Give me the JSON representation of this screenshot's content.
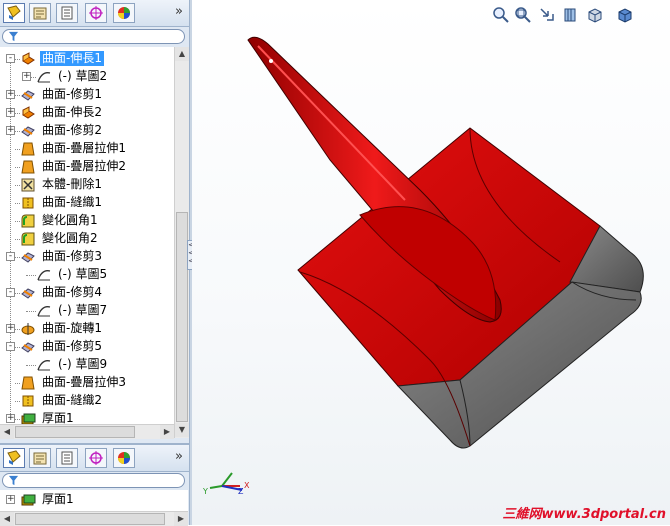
{
  "panel_top": {
    "tabs": [
      "feature-manager-icon",
      "property-manager-icon",
      "configuration-manager-icon",
      "dimxpert-icon",
      "display-manager-icon"
    ],
    "more_label": "»"
  },
  "tree": [
    {
      "label": "曲面-伸長1",
      "icon": "extrude-surface-icon",
      "expand": "-",
      "level": 0,
      "selected": true
    },
    {
      "label": "(-) 草圖2",
      "icon": "sketch-icon",
      "expand": "+",
      "level": 1
    },
    {
      "label": "曲面-修剪1",
      "icon": "trim-surface-icon",
      "expand": "+",
      "level": 0
    },
    {
      "label": "曲面-伸長2",
      "icon": "extrude-surface-icon",
      "expand": "+",
      "level": 0
    },
    {
      "label": "曲面-修剪2",
      "icon": "trim-surface-icon",
      "expand": "+",
      "level": 0
    },
    {
      "label": "曲面-疊層拉伸1",
      "icon": "loft-surface-icon",
      "expand": "",
      "level": 0
    },
    {
      "label": "曲面-疊層拉伸2",
      "icon": "loft-surface-icon",
      "expand": "",
      "level": 0
    },
    {
      "label": "本體-刪除1",
      "icon": "delete-body-icon",
      "expand": "",
      "level": 0
    },
    {
      "label": "曲面-縫織1",
      "icon": "knit-surface-icon",
      "expand": "",
      "level": 0
    },
    {
      "label": "變化圓角1",
      "icon": "fillet-icon",
      "expand": "",
      "level": 0
    },
    {
      "label": "變化圓角2",
      "icon": "fillet-icon",
      "expand": "",
      "level": 0
    },
    {
      "label": "曲面-修剪3",
      "icon": "trim-surface-icon",
      "expand": "-",
      "level": 0
    },
    {
      "label": "(-) 草圖5",
      "icon": "sketch-icon",
      "expand": "",
      "level": 1
    },
    {
      "label": "曲面-修剪4",
      "icon": "trim-surface-icon",
      "expand": "-",
      "level": 0
    },
    {
      "label": "(-) 草圖7",
      "icon": "sketch-icon",
      "expand": "",
      "level": 1
    },
    {
      "label": "曲面-旋轉1",
      "icon": "revolve-surface-icon",
      "expand": "+",
      "level": 0
    },
    {
      "label": "曲面-修剪5",
      "icon": "trim-surface-icon",
      "expand": "-",
      "level": 0
    },
    {
      "label": "(-) 草圖9",
      "icon": "sketch-icon",
      "expand": "",
      "level": 1
    },
    {
      "label": "曲面-疊層拉伸3",
      "icon": "loft-surface-icon",
      "expand": "",
      "level": 0
    },
    {
      "label": "曲面-縫織2",
      "icon": "knit-surface-icon",
      "expand": "",
      "level": 0
    },
    {
      "label": "厚面1",
      "icon": "thicken-icon",
      "expand": "+",
      "level": 0
    }
  ],
  "panel_bottom": {
    "tabs": [
      "feature-manager-icon",
      "property-manager-icon",
      "configuration-manager-icon",
      "dimxpert-icon",
      "display-manager-icon"
    ],
    "more_label": "»",
    "tree": [
      {
        "label": "厚面1",
        "icon": "thicken-icon",
        "expand": "+"
      }
    ]
  },
  "view_toolbar": [
    "zoom-to-fit-icon",
    "zoom-to-area-icon",
    "previous-view-icon",
    "section-view-icon",
    "view-orientation-icon",
    "display-style-icon"
  ],
  "watermark": "三維网www.3dportal.cn",
  "triad": {
    "x": "X",
    "y": "Y",
    "z": "Z"
  },
  "colors": {
    "model_red": "#d00000",
    "model_gray": "#6e6e6e",
    "selection": "#3399ff",
    "watermark": "#e0102a"
  }
}
